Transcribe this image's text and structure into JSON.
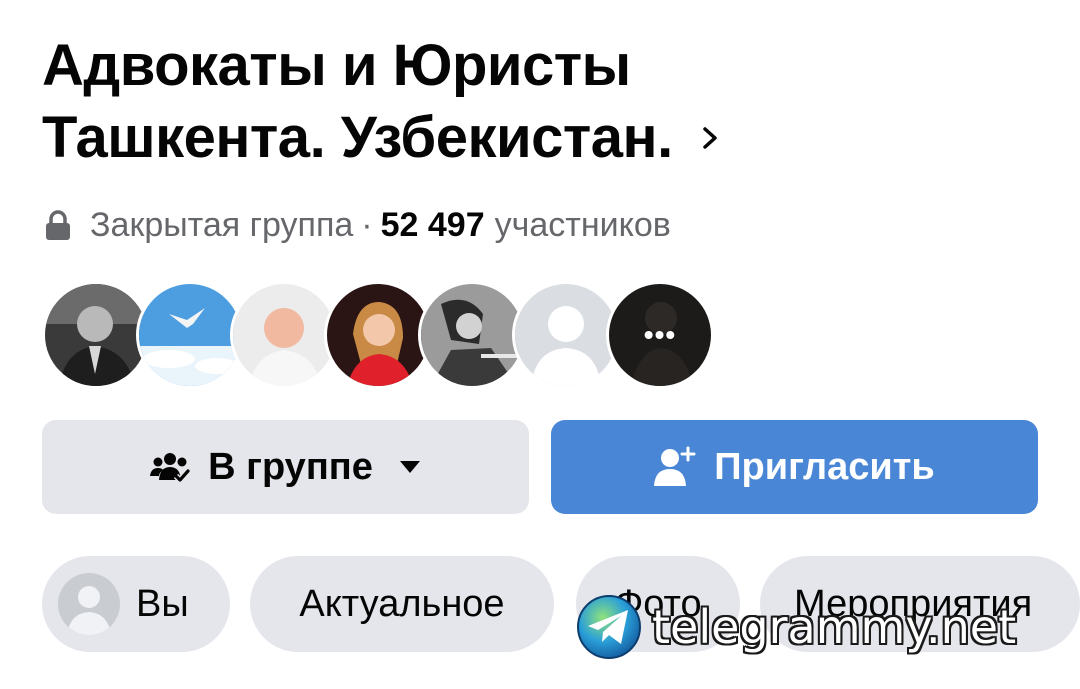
{
  "group": {
    "title_line1": "Адвокаты и Юристы",
    "title_line2": "Ташкента. Узбекистан.",
    "privacy": "Закрытая группа",
    "separator": "·",
    "member_count": "52 497",
    "member_label": "участников"
  },
  "members_preview": {
    "avatars": [
      "member-avatar-1",
      "member-avatar-2",
      "member-avatar-3",
      "member-avatar-4",
      "member-avatar-5",
      "member-avatar-6"
    ],
    "more_label": "•••"
  },
  "actions": {
    "joined_label": "В группе",
    "invite_label": "Пригласить"
  },
  "tabs": [
    {
      "label": "Вы"
    },
    {
      "label": "Актуальное"
    },
    {
      "label": "Фото"
    },
    {
      "label": "Мероприятия"
    }
  ],
  "watermark": {
    "text": "telegrammy.net"
  },
  "colors": {
    "primary_button": "#4a86d6",
    "secondary_button": "#e4e6eb",
    "text_primary": "#050505",
    "text_secondary": "#65676b"
  },
  "icons": {
    "title_chevron": "chevron-right-icon",
    "privacy": "lock-icon",
    "joined": "group-check-icon",
    "joined_caret": "caret-down-icon",
    "invite": "add-person-icon",
    "more_members": "more-dots-icon"
  }
}
